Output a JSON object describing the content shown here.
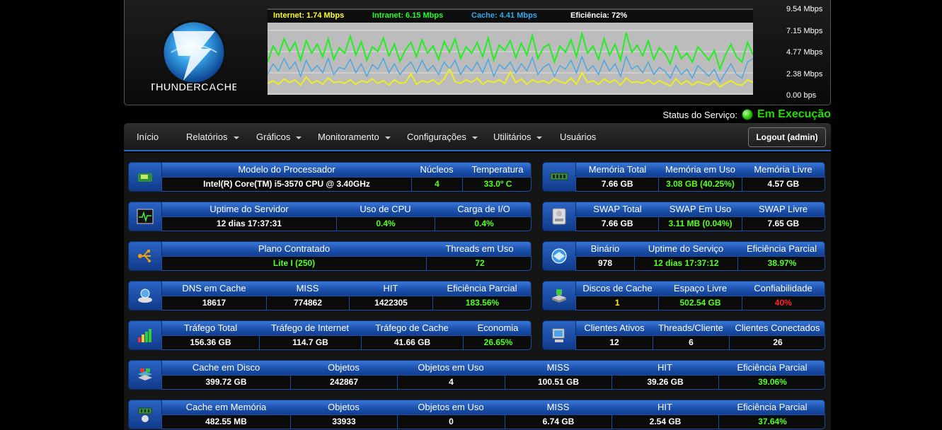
{
  "header": {
    "logo_text": "THUNDERCACHE",
    "legend": [
      {
        "label": "Internet: 1.74 Mbps",
        "color": "#ffff22"
      },
      {
        "label": "Intranet: 6.15 Mbps",
        "color": "#22ff22"
      },
      {
        "label": "Cache: 4.41 Mbps",
        "color": "#33aaee"
      },
      {
        "label": "Eficiência: 72%",
        "color": "#ffffff"
      }
    ],
    "y_labels": [
      "9.54 Mbps",
      "7.15 Mbps",
      "4.77 Mbps",
      "2.38 Mbps",
      "0.00 bps"
    ]
  },
  "chart_data": {
    "type": "line",
    "ylim": [
      0,
      9.54
    ],
    "ylabel": "",
    "grid": true,
    "series": [
      {
        "name": "Intranet",
        "color": "#22ee22",
        "values": [
          3.6,
          5.4,
          4.4,
          6.2,
          4.8,
          5.8,
          3.8,
          6.0,
          4.6,
          5.6,
          4.2,
          6.2,
          3.9,
          5.2,
          4.6,
          6.5,
          4.4,
          5.9,
          3.8,
          5.3,
          4.8,
          6.3,
          4.3,
          5.6,
          3.7,
          5.0,
          5.8,
          4.2,
          6.1,
          4.6,
          5.4,
          3.9,
          5.9,
          4.7,
          6.2,
          4.0,
          5.3,
          4.6,
          5.8,
          4.2,
          6.3,
          3.8,
          5.5,
          4.9,
          6.0,
          4.1,
          5.7,
          4.4,
          6.6,
          4.0,
          5.2,
          5.6,
          3.6,
          5.4,
          4.7,
          6.1,
          4.2,
          6.8,
          4.6,
          5.4,
          3.9,
          6.2,
          4.4,
          5.6,
          3.8,
          6.9,
          4.7,
          5.5,
          4.3,
          6.0,
          3.9,
          5.2,
          4.6,
          3.4,
          5.4,
          4.0,
          4.6,
          3.6,
          5.3,
          4.6,
          3.8,
          4.9,
          2.8,
          4.4,
          5.6,
          4.2,
          3.6,
          5.8,
          4.4
        ]
      },
      {
        "name": "Cache",
        "color": "#44a6e6",
        "values": [
          2.2,
          3.4,
          2.6,
          4.0,
          2.8,
          3.6,
          2.0,
          3.8,
          2.6,
          3.2,
          2.4,
          4.0,
          2.2,
          3.0,
          2.8,
          3.9,
          2.4,
          3.4,
          2.0,
          3.3,
          2.8,
          4.0,
          2.4,
          3.4,
          2.2,
          3.0,
          3.6,
          2.4,
          3.8,
          2.6,
          3.2,
          2.2,
          3.6,
          2.8,
          3.8,
          2.2,
          3.2,
          2.6,
          3.6,
          2.4,
          3.9,
          2.0,
          3.3,
          2.8,
          3.6,
          2.4,
          3.4,
          2.6,
          4.1,
          2.2,
          3.0,
          3.4,
          2.0,
          3.2,
          2.8,
          3.8,
          2.4,
          4.2,
          2.6,
          3.2,
          2.2,
          3.8,
          2.6,
          3.4,
          2.0,
          4.2,
          2.8,
          3.2,
          2.4,
          3.6,
          2.2,
          3.0,
          2.6,
          1.8,
          3.2,
          2.2,
          2.8,
          1.8,
          3.2,
          2.6,
          2.0,
          2.8,
          1.4,
          2.4,
          3.4,
          2.2,
          1.8,
          3.6,
          4.0
        ]
      },
      {
        "name": "Internet",
        "color": "#eeee22",
        "values": [
          1.2,
          1.5,
          1.1,
          1.7,
          1.3,
          1.6,
          1.0,
          1.9,
          1.2,
          1.5,
          1.1,
          1.8,
          1.3,
          1.4,
          1.2,
          1.6,
          1.1,
          1.5,
          1.3,
          1.7,
          1.2,
          1.5,
          1.0,
          1.6,
          1.2,
          1.3,
          2.3,
          1.1,
          1.5,
          1.3,
          1.6,
          1.1,
          1.7,
          2.8,
          1.4,
          1.2,
          1.6,
          1.3,
          1.8,
          1.1,
          1.5,
          1.3,
          1.6,
          1.2,
          2.5,
          1.3,
          1.7,
          1.1,
          1.6,
          1.3,
          1.5,
          1.2,
          1.7,
          1.4,
          1.2,
          1.8,
          1.1,
          2.4,
          1.3,
          1.5,
          1.1,
          1.7,
          1.3,
          1.6,
          1.0,
          1.8,
          1.3,
          1.4,
          1.2,
          1.6,
          1.1,
          1.5,
          1.2,
          0.9,
          1.7,
          1.1,
          1.5,
          1.0,
          1.4,
          1.2,
          1.0,
          1.5,
          0.8,
          1.2,
          1.5,
          1.1,
          1.0,
          1.6,
          1.3
        ]
      }
    ]
  },
  "status": {
    "label": "Status do Serviço:",
    "value": "Em Execução"
  },
  "nav": {
    "items": [
      "Início",
      "Relatórios",
      "Gráficos",
      "Monitoramento",
      "Configurações",
      "Utilitários",
      "Usuários"
    ],
    "logout": "Logout (admin)"
  },
  "cards": {
    "cpu": {
      "headers": [
        "Modelo do Processador",
        "Núcleos",
        "Temperatura"
      ],
      "values": [
        "Intel(R) Core(TM) i5-3570 CPU @ 3.40GHz",
        "4",
        "33.0º C"
      ]
    },
    "mem": {
      "headers": [
        "Memória Total",
        "Memória em Uso",
        "Memória Livre"
      ],
      "values": [
        "7.66 GB",
        "3.08 GB (40.25%)",
        "4.57 GB"
      ]
    },
    "uptime": {
      "headers": [
        "Uptime do Servidor",
        "Uso de CPU",
        "Carga de I/O"
      ],
      "values": [
        "12 dias 17:37:31",
        "0.4%",
        "0.4%"
      ]
    },
    "swap": {
      "headers": [
        "SWAP Total",
        "SWAP Em Uso",
        "SWAP Livre"
      ],
      "values": [
        "7.66 GB",
        "3.11 MB (0.04%)",
        "7.65 GB"
      ]
    },
    "plan": {
      "headers": [
        "Plano Contratado",
        "Threads em Uso"
      ],
      "values": [
        "Lite I (250)",
        "72"
      ]
    },
    "binary": {
      "headers": [
        "Binário",
        "Uptime do Serviço",
        "Eficiência Parcial"
      ],
      "values": [
        "978",
        "12 dias 17:37:12",
        "38.97%"
      ]
    },
    "dns": {
      "headers": [
        "DNS em Cache",
        "MISS",
        "HIT",
        "Eficiência Parcial"
      ],
      "values": [
        "18617",
        "774862",
        "1422305",
        "183.56%"
      ]
    },
    "disks": {
      "headers": [
        "Discos de Cache",
        "Espaço Livre",
        "Confiabilidade"
      ],
      "values": [
        "1",
        "502.54 GB",
        "40%"
      ]
    },
    "traffic": {
      "headers": [
        "Tráfego Total",
        "Tráfego de Internet",
        "Tráfego de Cache",
        "Economia"
      ],
      "values": [
        "156.36 GB",
        "114.7 GB",
        "41.66 GB",
        "26.65%"
      ]
    },
    "clients": {
      "headers": [
        "Clientes Ativos",
        "Threads/Cliente",
        "Clientes Conectados"
      ],
      "values": [
        "12",
        "6",
        "26"
      ]
    },
    "disk_cache": {
      "headers": [
        "Cache em Disco",
        "Objetos",
        "Objetos em Uso",
        "MISS",
        "HIT",
        "Eficiência Parcial"
      ],
      "values": [
        "399.72 GB",
        "242867",
        "4",
        "100.51 GB",
        "39.26 GB",
        "39.06%"
      ]
    },
    "mem_cache": {
      "headers": [
        "Cache em Memória",
        "Objetos",
        "Objetos em Uso",
        "MISS",
        "HIT",
        "Eficiência Parcial"
      ],
      "values": [
        "482.55 MB",
        "33933",
        "0",
        "6.74 GB",
        "2.54 GB",
        "37.64%"
      ]
    }
  }
}
